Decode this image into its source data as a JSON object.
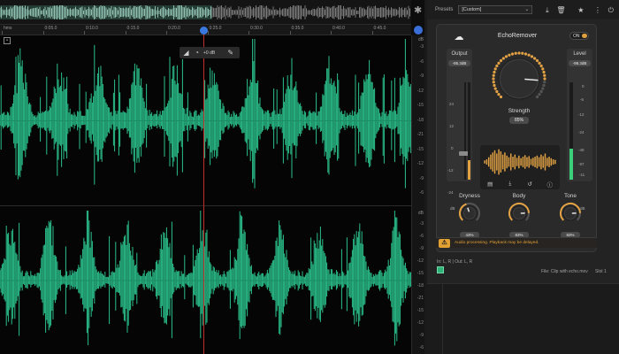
{
  "editor": {
    "ruler": {
      "ticks": [
        "hms",
        "0:05.0",
        "0:10.0",
        "0:15.0",
        "0:20.0",
        "0:25.0",
        "0:30.0",
        "0:35.0",
        "0:40.0",
        "0:45.0"
      ]
    },
    "hud": {
      "gain": "+0 dB"
    },
    "db_scale": {
      "top_unit": "dB",
      "channel1": [
        "-3",
        "-6",
        "-9",
        "-12",
        "-15",
        "-18",
        "-21",
        "-15",
        "-12",
        "-9",
        "-6"
      ],
      "bottom_unit": "dB",
      "channel2": [
        "-3",
        "-6",
        "-9",
        "-12",
        "-15",
        "-18",
        "-21",
        "-15",
        "-12",
        "-9",
        "-6"
      ]
    },
    "wave_color": "#2fd49a",
    "playhead_color": "#c22d2d"
  },
  "presets": {
    "label": "Presets",
    "selected": "[Custom]"
  },
  "plugin": {
    "title": "EchoRemover",
    "power_label": "ON",
    "accent": "#e2a244",
    "output": {
      "title": "Output",
      "value": "-85.3dB",
      "scale": [
        "24",
        "12",
        "0",
        "-12",
        "-24",
        "dB"
      ],
      "fader_level": 0.22,
      "meter_level": 0.2
    },
    "level": {
      "title": "Level",
      "value": "-98.3dB",
      "scale": [
        "0",
        "-6",
        "-12",
        "-24",
        "-48",
        "-97",
        "-11",
        "dB"
      ],
      "meter_level": 0.32
    },
    "strength": {
      "label": "Strength",
      "value": "85%",
      "level": 0.85
    },
    "visualizer_bars": [
      3,
      5,
      9,
      14,
      18,
      22,
      16,
      24,
      20,
      14,
      18,
      12,
      9,
      16,
      10,
      14,
      8,
      12,
      7,
      10,
      13,
      9,
      11,
      6,
      8,
      10,
      12,
      9,
      14,
      11,
      16,
      8,
      10,
      7,
      5,
      4
    ],
    "visualizer_icons": [
      "save-icon",
      "download-icon",
      "undo-icon",
      "help-icon"
    ],
    "knobs": [
      {
        "name": "Dryness",
        "value": "43%",
        "level": 0.43
      },
      {
        "name": "Body",
        "value": "83%",
        "level": 0.83
      },
      {
        "name": "Tone",
        "value": "83%",
        "level": 0.83
      }
    ],
    "warning": "Audio processing. Playback may be delayed."
  },
  "footer": {
    "io": "In: L, R | Out: L, R",
    "file": "File: Clip with echo.mov",
    "slot": "Slot 1"
  }
}
